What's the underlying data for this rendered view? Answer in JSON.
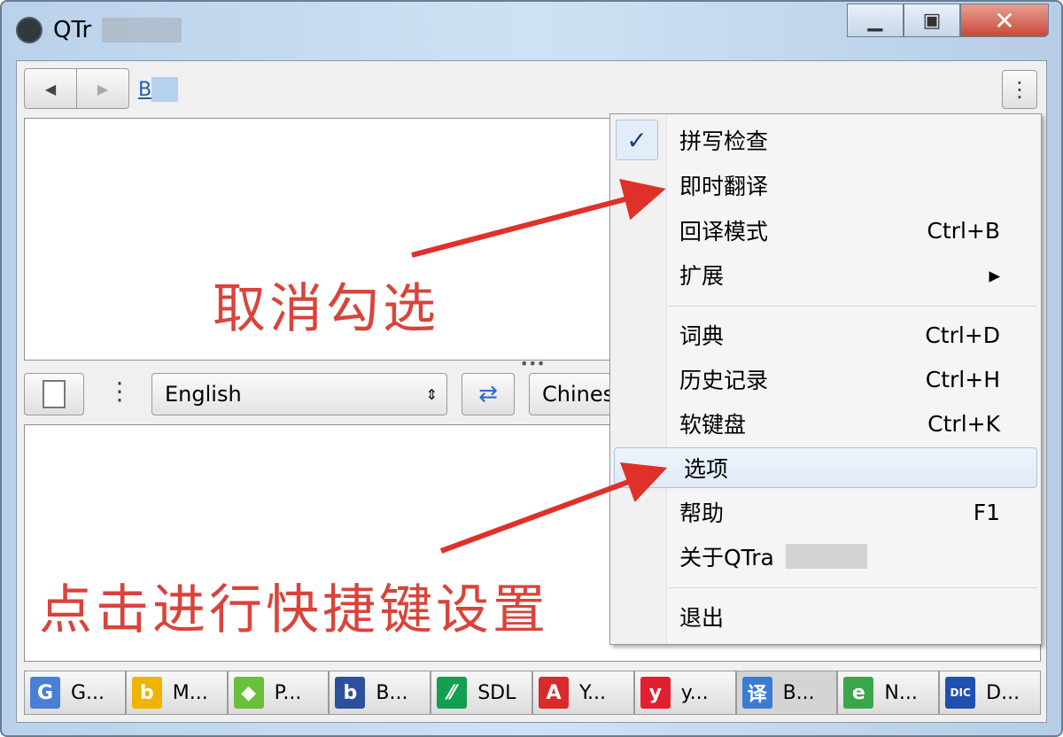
{
  "window": {
    "title_visible": "QTr"
  },
  "toolbar": {
    "back": "◀",
    "forward": "▶",
    "link_visible": "B"
  },
  "source_lang": "English",
  "target_lang": "Chines",
  "annotations": {
    "top": "取消勾选",
    "bottom": "点击进行快捷键设置",
    "color": "#d8443b"
  },
  "menu": {
    "items": [
      {
        "label": "拼写检查",
        "shortcut": "",
        "checked": true
      },
      {
        "label": "即时翻译",
        "shortcut": ""
      },
      {
        "label": "回译模式",
        "shortcut": "Ctrl+B"
      },
      {
        "label": "扩展",
        "shortcut": "▸"
      },
      {
        "label": "词典",
        "shortcut": "Ctrl+D"
      },
      {
        "label": "历史记录",
        "shortcut": "Ctrl+H"
      },
      {
        "label": "软键盘",
        "shortcut": "Ctrl+K"
      },
      {
        "label": "选项",
        "shortcut": "",
        "highlighted": true
      },
      {
        "label": "帮助",
        "shortcut": "F1"
      },
      {
        "label": "关于QTra",
        "shortcut": ""
      },
      {
        "label": "退出",
        "shortcut": ""
      }
    ]
  },
  "tabs": [
    {
      "icon": "G",
      "label": "G...",
      "color": "#4a7fd8"
    },
    {
      "icon": "b",
      "label": "M...",
      "color": "#f0b400"
    },
    {
      "icon": "◆",
      "label": "P...",
      "color": "#6bbf3a"
    },
    {
      "icon": "b",
      "label": "B...",
      "color": "#2c4f9e"
    },
    {
      "icon": "⁄⁄",
      "label": "SDL",
      "color": "#12a050"
    },
    {
      "icon": "A",
      "label": "Y...",
      "color": "#d82c2c"
    },
    {
      "icon": "y",
      "label": "y...",
      "color": "#e02030"
    },
    {
      "icon": "译",
      "label": "B...",
      "color": "#3b7bd4"
    },
    {
      "icon": "e",
      "label": "N...",
      "color": "#3aa84a"
    },
    {
      "icon": "DIC",
      "label": "D...",
      "color": "#2050b0"
    }
  ]
}
